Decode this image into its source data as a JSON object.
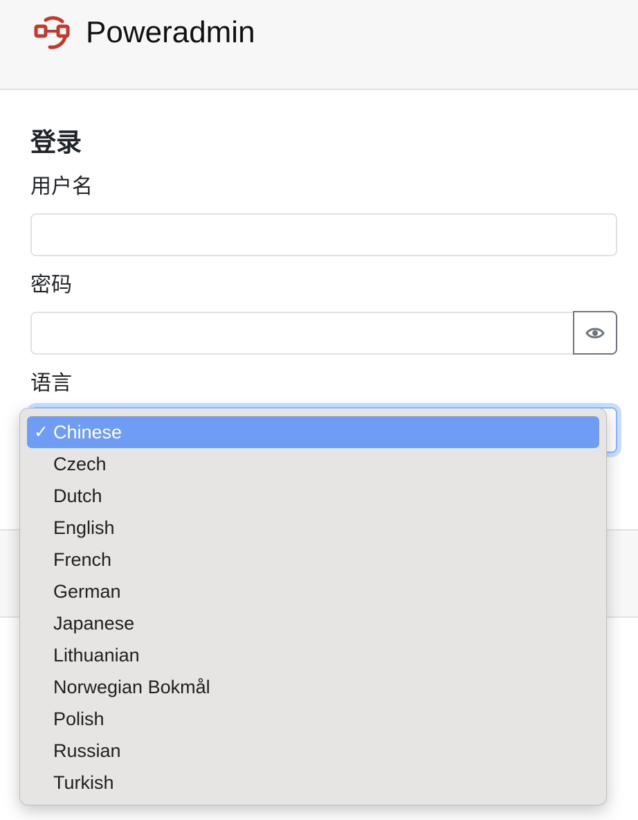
{
  "brand": {
    "name": "Poweradmin",
    "logo_color": "#c0392b"
  },
  "login": {
    "title": "登录",
    "username_label": "用户名",
    "password_label": "密码",
    "language_label": "语言",
    "username_value": "",
    "password_value": ""
  },
  "language_select": {
    "selected": "Chinese",
    "check_glyph": "✓",
    "options": [
      "Chinese",
      "Czech",
      "Dutch",
      "English",
      "French",
      "German",
      "Japanese",
      "Lithuanian",
      "Norwegian Bokmål",
      "Polish",
      "Russian",
      "Turkish"
    ]
  },
  "icons": {
    "logo": "network-nodes-icon",
    "password_toggle": "eye-icon"
  },
  "colors": {
    "selected_option_bg": "#6f9df5",
    "focus_ring": "#86b7fe"
  }
}
